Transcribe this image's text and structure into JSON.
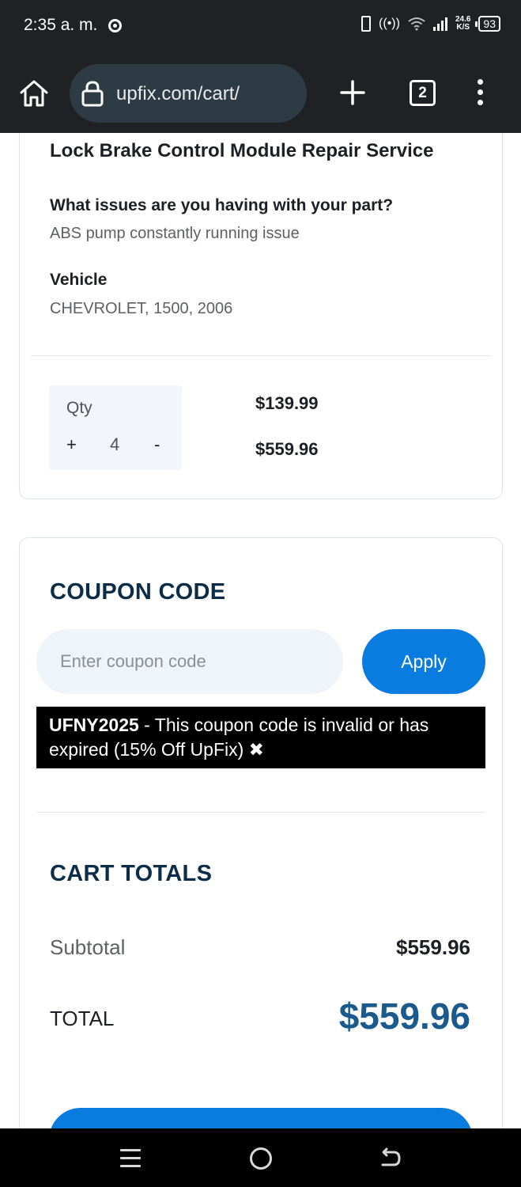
{
  "status_bar": {
    "time": "2:35 a. m.",
    "net_speed_value": "24.6",
    "net_speed_unit": "K/S",
    "battery": "93"
  },
  "browser": {
    "url": "upfix.com/cart/",
    "tab_count": "2"
  },
  "cart_item": {
    "title": "Lock Brake Control Module Repair Service",
    "issue_label": "What issues are you having with your part?",
    "issue_value": "ABS pump constantly running issue",
    "vehicle_label": "Vehicle",
    "vehicle_value": "CHEVROLET, 1500, 2006",
    "qty_label": "Qty",
    "qty_plus": "+",
    "qty_value": "4",
    "qty_minus": "-",
    "unit_price": "$139.99",
    "line_total": "$559.96"
  },
  "coupon": {
    "title": "COUPON CODE",
    "placeholder": "Enter coupon code",
    "apply_label": "Apply",
    "error_code": "UFNY2025",
    "error_message": " - This coupon code is invalid or has expired (15% Off UpFix) ✖"
  },
  "totals": {
    "title": "CART TOTALS",
    "subtotal_label": "Subtotal",
    "subtotal_value": "$559.96",
    "total_label": "TOTAL",
    "total_value": "$559.96"
  },
  "colors": {
    "primary": "#0a7cdf",
    "heading": "#0c2d48",
    "total_accent": "#1a5a8c",
    "chrome_bar": "#1f2125"
  }
}
